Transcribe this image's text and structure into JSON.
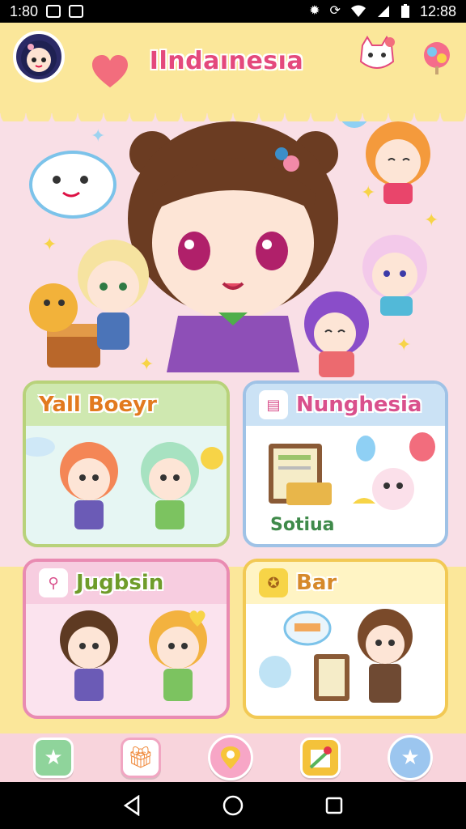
{
  "status_bar": {
    "time_left": "1:80",
    "time_right": "12:88",
    "left_icons": [
      "image-icon",
      "media-icon"
    ],
    "right_icons": [
      "settings-icon",
      "sync-icon",
      "wifi-icon",
      "signal-icon",
      "battery-icon"
    ]
  },
  "header": {
    "title": "Ilndaınesıa",
    "avatar": "avatar",
    "heart": "heart-icon",
    "icons": [
      "cat-sticker-icon",
      "candy-icon"
    ]
  },
  "hero": {
    "bubble_text": "",
    "decor": [
      "speech-bubble-icon",
      "balloon-icon",
      "sparkle-icon",
      "treasure-chest-icon",
      "bear-icon"
    ]
  },
  "cards": [
    {
      "id": "yall-boys",
      "title": "Yall Boeyr",
      "icon": "",
      "caption": "",
      "accent": "#e27a1f",
      "head_bg": "#cfe8b0",
      "body_bg": "#e6f6f3",
      "border": "#b8d27a"
    },
    {
      "id": "nunghesia",
      "title": "Nunghesia",
      "icon": "notebook-icon",
      "caption": "Sotiua",
      "accent": "#d9508c",
      "head_bg": "#cbe2f5",
      "body_bg": "#ffffff",
      "border": "#9fc2e6"
    },
    {
      "id": "jugbsin",
      "title": "Jugbsin",
      "icon": "pin-icon",
      "caption": "",
      "accent": "#6f9c2a",
      "head_bg": "#f7cde0",
      "body_bg": "#fbe3ee",
      "border": "#e98bb2"
    },
    {
      "id": "bar",
      "title": "Bar",
      "icon": "badge-icon",
      "caption": "",
      "accent": "#d6892a",
      "head_bg": "#fff4c4",
      "body_bg": "#ffffff",
      "border": "#f2c954"
    }
  ],
  "bottom_nav": [
    {
      "icon": "star-icon",
      "color": "#8fd49b"
    },
    {
      "icon": "gift-icon",
      "color": "#ffffff"
    },
    {
      "icon": "map-pin-icon",
      "color": "#f7a6c6"
    },
    {
      "icon": "map-icon",
      "color": "#f4c23a"
    },
    {
      "icon": "favorite-star-icon",
      "color": "#9cc6ef"
    }
  ],
  "system_nav": [
    "back-icon",
    "home-icon",
    "recents-icon"
  ]
}
